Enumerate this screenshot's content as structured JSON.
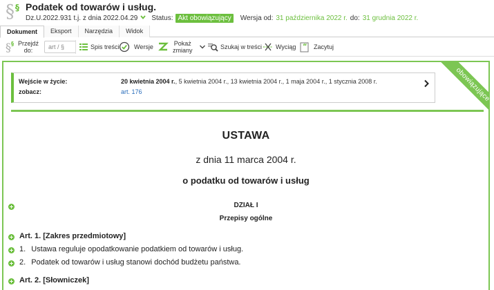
{
  "header": {
    "title": "Podatek od towarów i usług.",
    "ref": "Dz.U.2022.931 t.j. z dnia 2022.04.29",
    "status_label": "Status:",
    "status_badge": "Akt obowiązujący",
    "version_label": "Wersja od:",
    "version_from": "31 października 2022 r.",
    "version_to_label": "do:",
    "version_to": "31 grudnia 2022 r."
  },
  "tabs": [
    {
      "label": "Dokument",
      "active": true
    },
    {
      "label": "Eksport"
    },
    {
      "label": "Narzędzia"
    },
    {
      "label": "Widok"
    }
  ],
  "toolbar": {
    "goto_label_1": "Przejdź",
    "goto_label_2": "do:",
    "goto_placeholder": "art / §",
    "toc": "Spis treści",
    "versions": "Wersje",
    "changes_1": "Pokaż",
    "changes_2": "zmiany",
    "search": "Szukaj w treści",
    "excerpt": "Wyciąg",
    "cite": "Zacytuj"
  },
  "info": {
    "effective_label": "Wejście w życie:",
    "effective_main": "20 kwietnia 2004 r.",
    "effective_rest": ", 5 kwietnia 2004 r., 13 kwietnia 2004 r., 1 maja 2004 r., 1 stycznia 2008 r.",
    "see_label": "zobacz:",
    "see_link": "art. 176"
  },
  "ribbon": "obowiązujące",
  "document": {
    "type": "USTAWA",
    "date": "z dnia 11 marca 2004 r.",
    "subject": "o podatku od towarów i usług",
    "division": "DZIAŁ  I",
    "division_title": "Przepisy ogólne",
    "art1": "Art.  1.   [Zakres przedmiotowy]",
    "art1_p1_num": "1.",
    "art1_p1": "Ustawa reguluje opodatkowanie podatkiem od towarów i usług.",
    "art1_p2_num": "2.",
    "art1_p2": "Podatek od towarów i usług stanowi dochód budżetu państwa.",
    "art2": "Art.  2.   [Słowniczek]"
  }
}
